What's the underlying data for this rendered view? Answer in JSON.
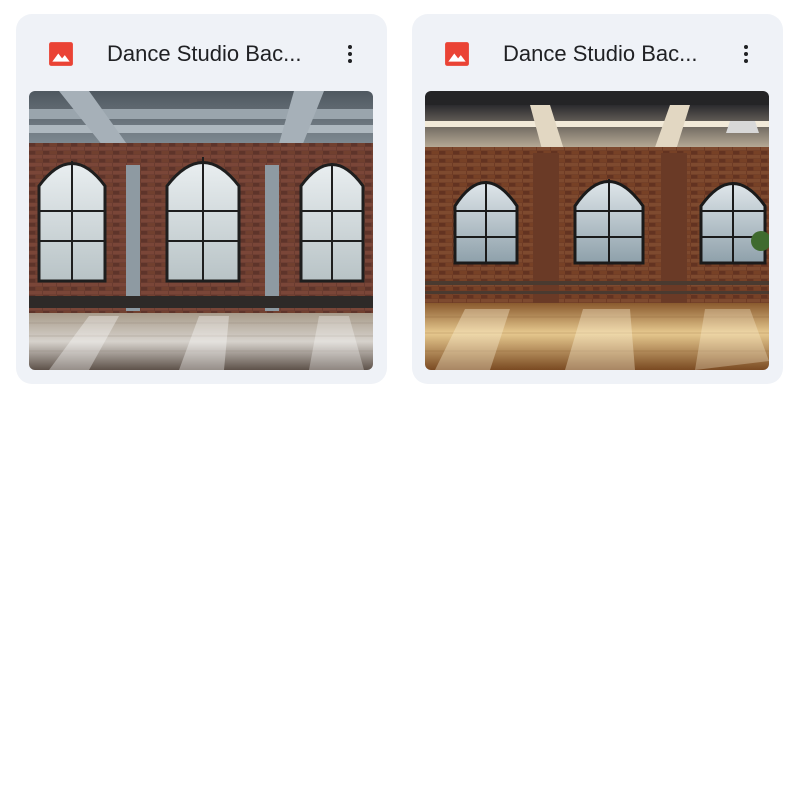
{
  "files": [
    {
      "title": "Dance Studio Bac...",
      "file_type_icon": "image-icon",
      "menu_icon": "more-vert-icon",
      "thumbnail_alt": "Dance studio interior with arched windows and brick walls"
    },
    {
      "title": "Dance Studio Bac...",
      "file_type_icon": "image-icon",
      "menu_icon": "more-vert-icon",
      "thumbnail_alt": "Warm-lit dance studio with brick walls and wooden floor"
    }
  ],
  "colors": {
    "card_bg": "#eff2f7",
    "title_text": "#202124",
    "image_icon_red": "#ea4335"
  }
}
